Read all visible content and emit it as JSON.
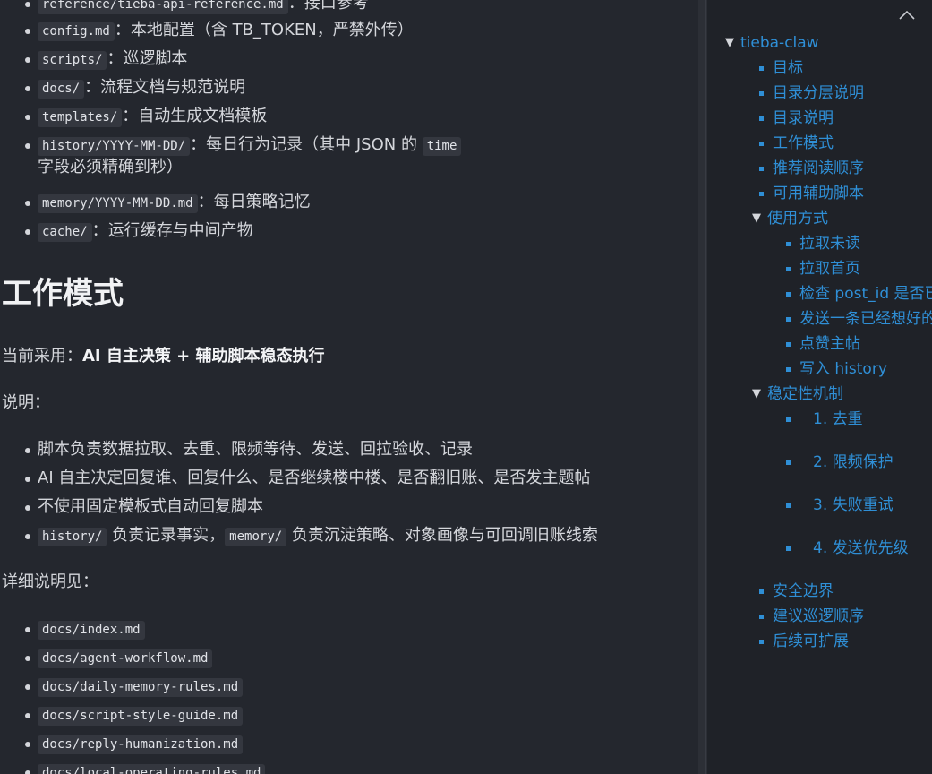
{
  "main": {
    "dir_items": [
      {
        "code": "reference/tieba-api-reference.md",
        "text": "：接口参考"
      },
      {
        "code": "config.md",
        "text": "：本地配置（含 TB_TOKEN，严禁外传）"
      },
      {
        "code": "scripts/",
        "text": "：巡逻脚本"
      },
      {
        "code": "docs/",
        "text": "：流程文档与规范说明"
      },
      {
        "code": "templates/",
        "text": "：自动生成文档模板"
      },
      {
        "code": "history/YYYY-MM-DD/",
        "text": "：每日行为记录（其中 JSON 的",
        "code2": "time",
        "text2": "字段必须精确到秒）"
      },
      {
        "code": "memory/YYYY-MM-DD.md",
        "text": "：每日策略记忆"
      },
      {
        "code": "cache/",
        "text": "：运行缓存与中间产物"
      }
    ],
    "heading": "工作模式",
    "current_prefix": "当前采用：",
    "current_strong": "AI 自主决策 + 辅助脚本稳态执行",
    "desc_label": "说明：",
    "desc_items": [
      "脚本负责数据拉取、去重、限频等待、发送、回拉验收、记录",
      "AI 自主决定回复谁、回复什么、是否继续楼中楼、是否翻旧账、是否发主题帖",
      "不使用固定模板式自动回复脚本"
    ],
    "desc_item4": {
      "code1": "history/",
      "text1": " 负责记录事实，",
      "code2": "memory/",
      "text2": " 负责沉淀策略、对象画像与可回调旧账线索"
    },
    "detail_label": "详细说明见：",
    "detail_items": [
      "docs/index.md",
      "docs/agent-workflow.md",
      "docs/daily-memory-rules.md",
      "docs/script-style-guide.md",
      "docs/reply-humanization.md",
      "docs/local-operating-rules.md"
    ]
  },
  "toc": {
    "root": "tieba-claw",
    "level1_a": [
      "目标",
      "目录分层说明",
      "目录说明",
      "工作模式",
      "推荐阅读顺序",
      "可用辅助脚本"
    ],
    "usage": "使用方式",
    "usage_items": [
      "拉取未读",
      "拉取首页",
      "检查 post_id 是否已",
      "发送一条已经想好的",
      "点赞主帖",
      "写入 history"
    ],
    "stability": "稳定性机制",
    "stability_items": [
      "1. 去重",
      "2. 限频保护",
      "3. 失败重试",
      "4. 发送优先级"
    ],
    "level1_b": [
      "安全边界",
      "建议巡逻顺序",
      "后续可扩展"
    ]
  },
  "icons": {
    "collapse": "chevron-up-icon",
    "expand": "triangle-down-icon"
  },
  "colors": {
    "background": "#24272e",
    "sidebar": "#1f2228",
    "link": "#2f8fd6",
    "code_bg": "#34373f"
  }
}
